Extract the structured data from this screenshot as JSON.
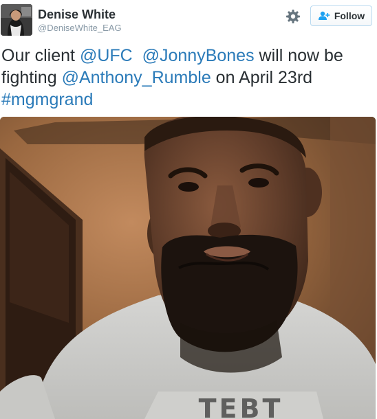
{
  "user": {
    "display_name": "Denise White",
    "screen_name": "@DeniseWhite_EAG"
  },
  "actions": {
    "follow_label": "Follow",
    "settings_icon": "gear-icon",
    "follow_icon": "add-user-icon"
  },
  "tweet": {
    "line1_prefix": "Our client ",
    "mention_ufc": "@UFC",
    "gap": "  ",
    "mention_jonny": "@JonnyBones",
    "line1_suffix": " will now be",
    "line2_prefix": "fighting ",
    "mention_anthony": "@Anthony_Rumble",
    "line2_suffix": " on April 23rd",
    "hashtag": "#mgmgrand"
  },
  "media": {
    "type": "video-still",
    "shirt_text": "TEBT"
  },
  "colors": {
    "link": "#2b7bb9",
    "text": "#292f33",
    "secondary": "#8899a6",
    "follow_blue": "#1da1f2"
  }
}
